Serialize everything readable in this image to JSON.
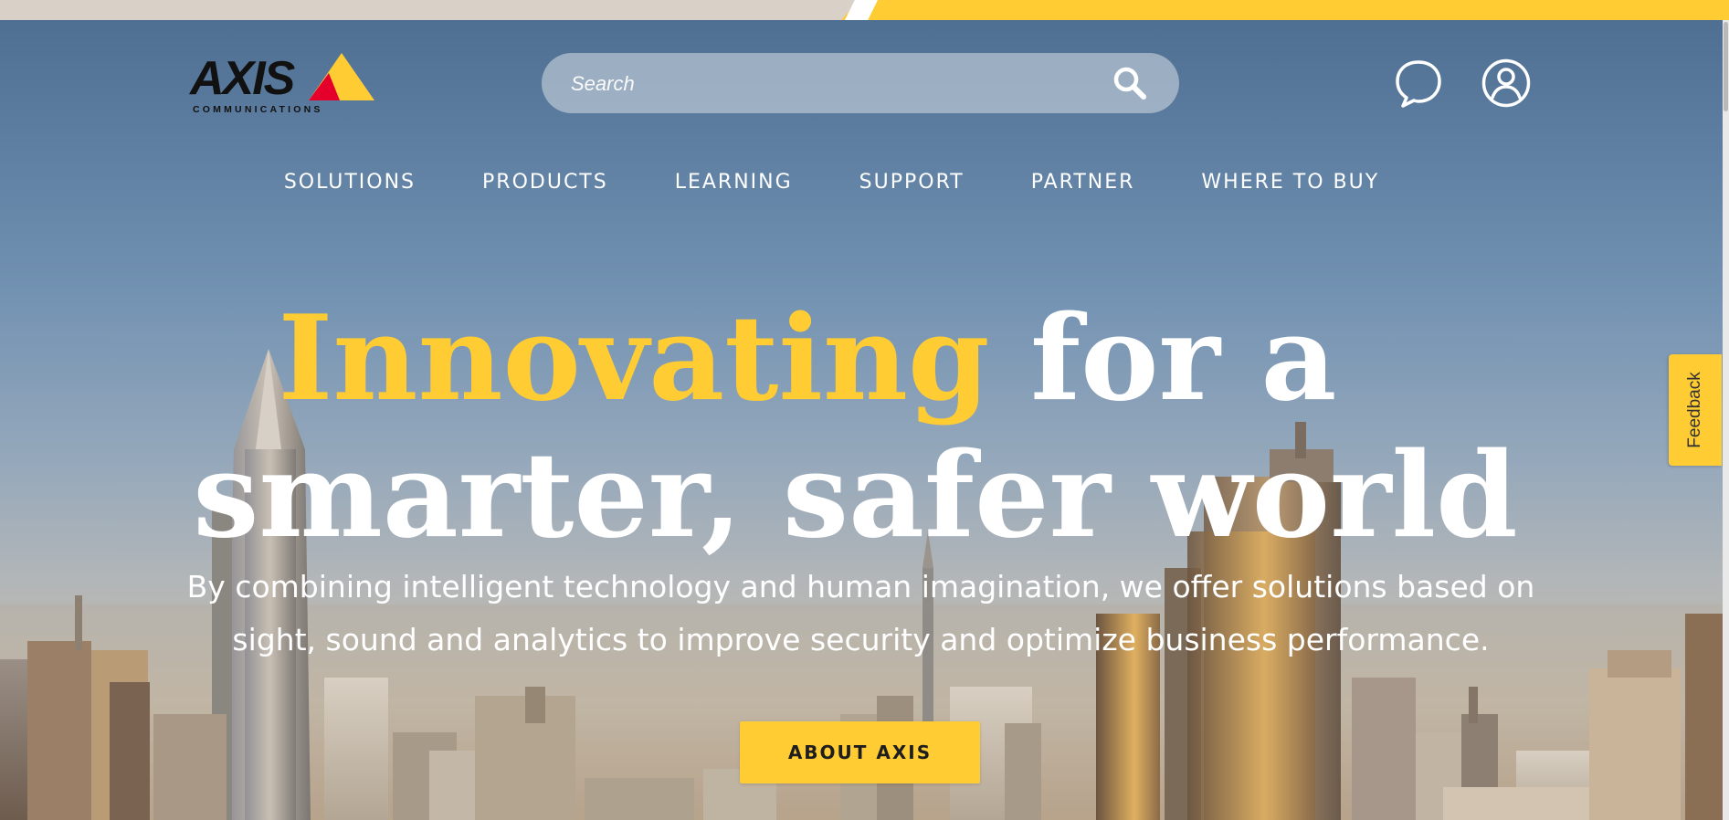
{
  "brand": {
    "logo_word": "AXIS",
    "logo_subtitle": "COMMUNICATIONS",
    "accent_color": "#ffcc33",
    "logo_red": "#e4002b",
    "logo_black": "#111111"
  },
  "header": {
    "search": {
      "placeholder": "Search",
      "value": "",
      "icon": "search-icon"
    },
    "actions": [
      {
        "icon": "chat-bubble-icon"
      },
      {
        "icon": "user-account-icon"
      }
    ]
  },
  "nav": {
    "items": [
      {
        "label": "SOLUTIONS"
      },
      {
        "label": "PRODUCTS"
      },
      {
        "label": "LEARNING"
      },
      {
        "label": "SUPPORT"
      },
      {
        "label": "PARTNER"
      },
      {
        "label": "WHERE TO BUY"
      }
    ]
  },
  "hero": {
    "title_accent": "Innovating",
    "title_rest_line1": " for a",
    "title_line2": "smarter, safer world",
    "description_line1": "By combining intelligent technology and human imagination, we offer solutions based on",
    "description_line2": "sight, sound and analytics to improve security and optimize business performance.",
    "cta_label": "ABOUT AXIS"
  },
  "feedback": {
    "label": "Feedback"
  }
}
